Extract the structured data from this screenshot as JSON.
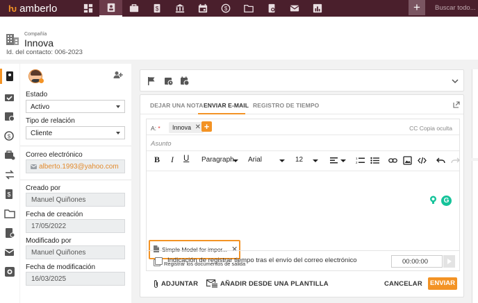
{
  "app": {
    "brand": "amberlo",
    "search_placeholder": "Buscar todo...",
    "add_label": "+"
  },
  "header": {
    "company_label": "Compañía",
    "company_name": "Innova",
    "contact_id": "Id. del contacto: 006-2023"
  },
  "details": {
    "estado_label": "Estado",
    "estado_value": "Activo",
    "tipo_label": "Tipo de relación",
    "tipo_value": "Cliente",
    "email_label": "Correo electrónico",
    "email_value": "alberto.1993@yahoo.com",
    "creado_label": "Creado por",
    "creado_value": "Manuel Quiñones",
    "fecha_creacion_label": "Fecha de creación",
    "fecha_creacion_value": "17/05/2022",
    "modificado_label": "Modificado por",
    "modificado_value": "Manuel Quiñones",
    "fecha_mod_label": "Fecha de modificación",
    "fecha_mod_value": "16/03/2025"
  },
  "tabs": {
    "note": "DEJAR UNA NOTA",
    "email": "ENVIAR E-MAIL",
    "time": "REGISTRO DE TIEMPO"
  },
  "email": {
    "to_label": "A:",
    "to_required": "*",
    "recipient": "Innova",
    "cc_label": "CC Copia oculta",
    "subject_placeholder": "Asunto",
    "attachment": "Simple Model for impor...",
    "register_docs": "Registrar los documentos de salida",
    "register_time": "Indicación de registrar tiempo tras el envío del correo electrónico",
    "time_value": "00:00:00"
  },
  "toolbar": {
    "bold": "B",
    "italic": "I",
    "underline": "U",
    "block": "Paragraph",
    "font": "Arial",
    "size": "12"
  },
  "footer": {
    "attach": "ADJUNTAR",
    "template": "AÑADIR DESDE UNA PLANTILLA",
    "cancel": "CANCELAR",
    "send": "ENVIAR"
  },
  "colors": {
    "accent": "#f39325",
    "topbar": "#4a1f2c",
    "email_link": "#e28a2c"
  }
}
